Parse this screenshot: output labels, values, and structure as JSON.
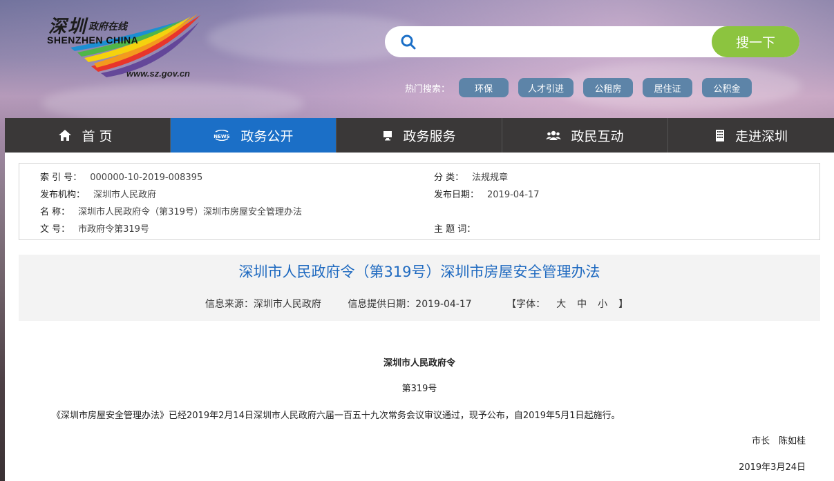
{
  "logo": {
    "cn_main": "深圳",
    "cn_sub": "政府在线",
    "en": "SHENZHEN  CHINA",
    "url": "www.sz.gov.cn",
    "icon": "rainbow-wings-logo"
  },
  "search": {
    "placeholder": "",
    "value": "",
    "button_label": "搜一下",
    "icon": "search-icon"
  },
  "hot_search": {
    "label": "热门搜索：",
    "tags": [
      "环保",
      "人才引进",
      "公租房",
      "居住证",
      "公积金"
    ]
  },
  "nav": {
    "items": [
      {
        "label": "首页",
        "icon": "home-icon"
      },
      {
        "label": "政务公开",
        "icon": "news-icon"
      },
      {
        "label": "政务服务",
        "icon": "monitor-icon"
      },
      {
        "label": "政民互动",
        "icon": "users-icon"
      },
      {
        "label": "走进深圳",
        "icon": "building-icon"
      }
    ],
    "active_index": 1
  },
  "meta": {
    "index_label": "索 引 号：",
    "index_value": "000000-10-2019-008395",
    "category_label": "分      类：",
    "category_value": "法规规章",
    "publisher_label": "发布机构：",
    "publisher_value": "深圳市人民政府",
    "date_label": "发布日期：",
    "date_value": "2019-04-17",
    "name_label": "名      称：",
    "name_value": "深圳市人民政府令（第319号）深圳市房屋安全管理办法",
    "docno_label": "文      号：",
    "docno_value": "市政府令第319号",
    "subject_label": "主 题 词："
  },
  "doc": {
    "title": "深圳市人民政府令（第319号）深圳市房屋安全管理办法",
    "source": "信息来源：深圳市人民政府",
    "provide_date": "信息提供日期：2019-04-17",
    "font_label_open": "【字体：",
    "font_large": "大",
    "font_medium": "中",
    "font_small": "小",
    "font_label_close": "】",
    "heading": "深圳市人民政府令",
    "number": "第319号",
    "paragraph": "《深圳市房屋安全管理办法》已经2019年2月14日深圳市人民政府六届一百五十九次常务会议审议通过，现予公布，自2019年5月1日起施行。",
    "signatory": "市长　陈如桂",
    "sign_date": "2019年3月24日"
  },
  "colors": {
    "nav_bg": "#3a3838",
    "nav_active": "#1b6fc7",
    "search_button": "#8cc43f",
    "hot_tag": "#5d84a8",
    "title_blue": "#1f6ac0"
  }
}
